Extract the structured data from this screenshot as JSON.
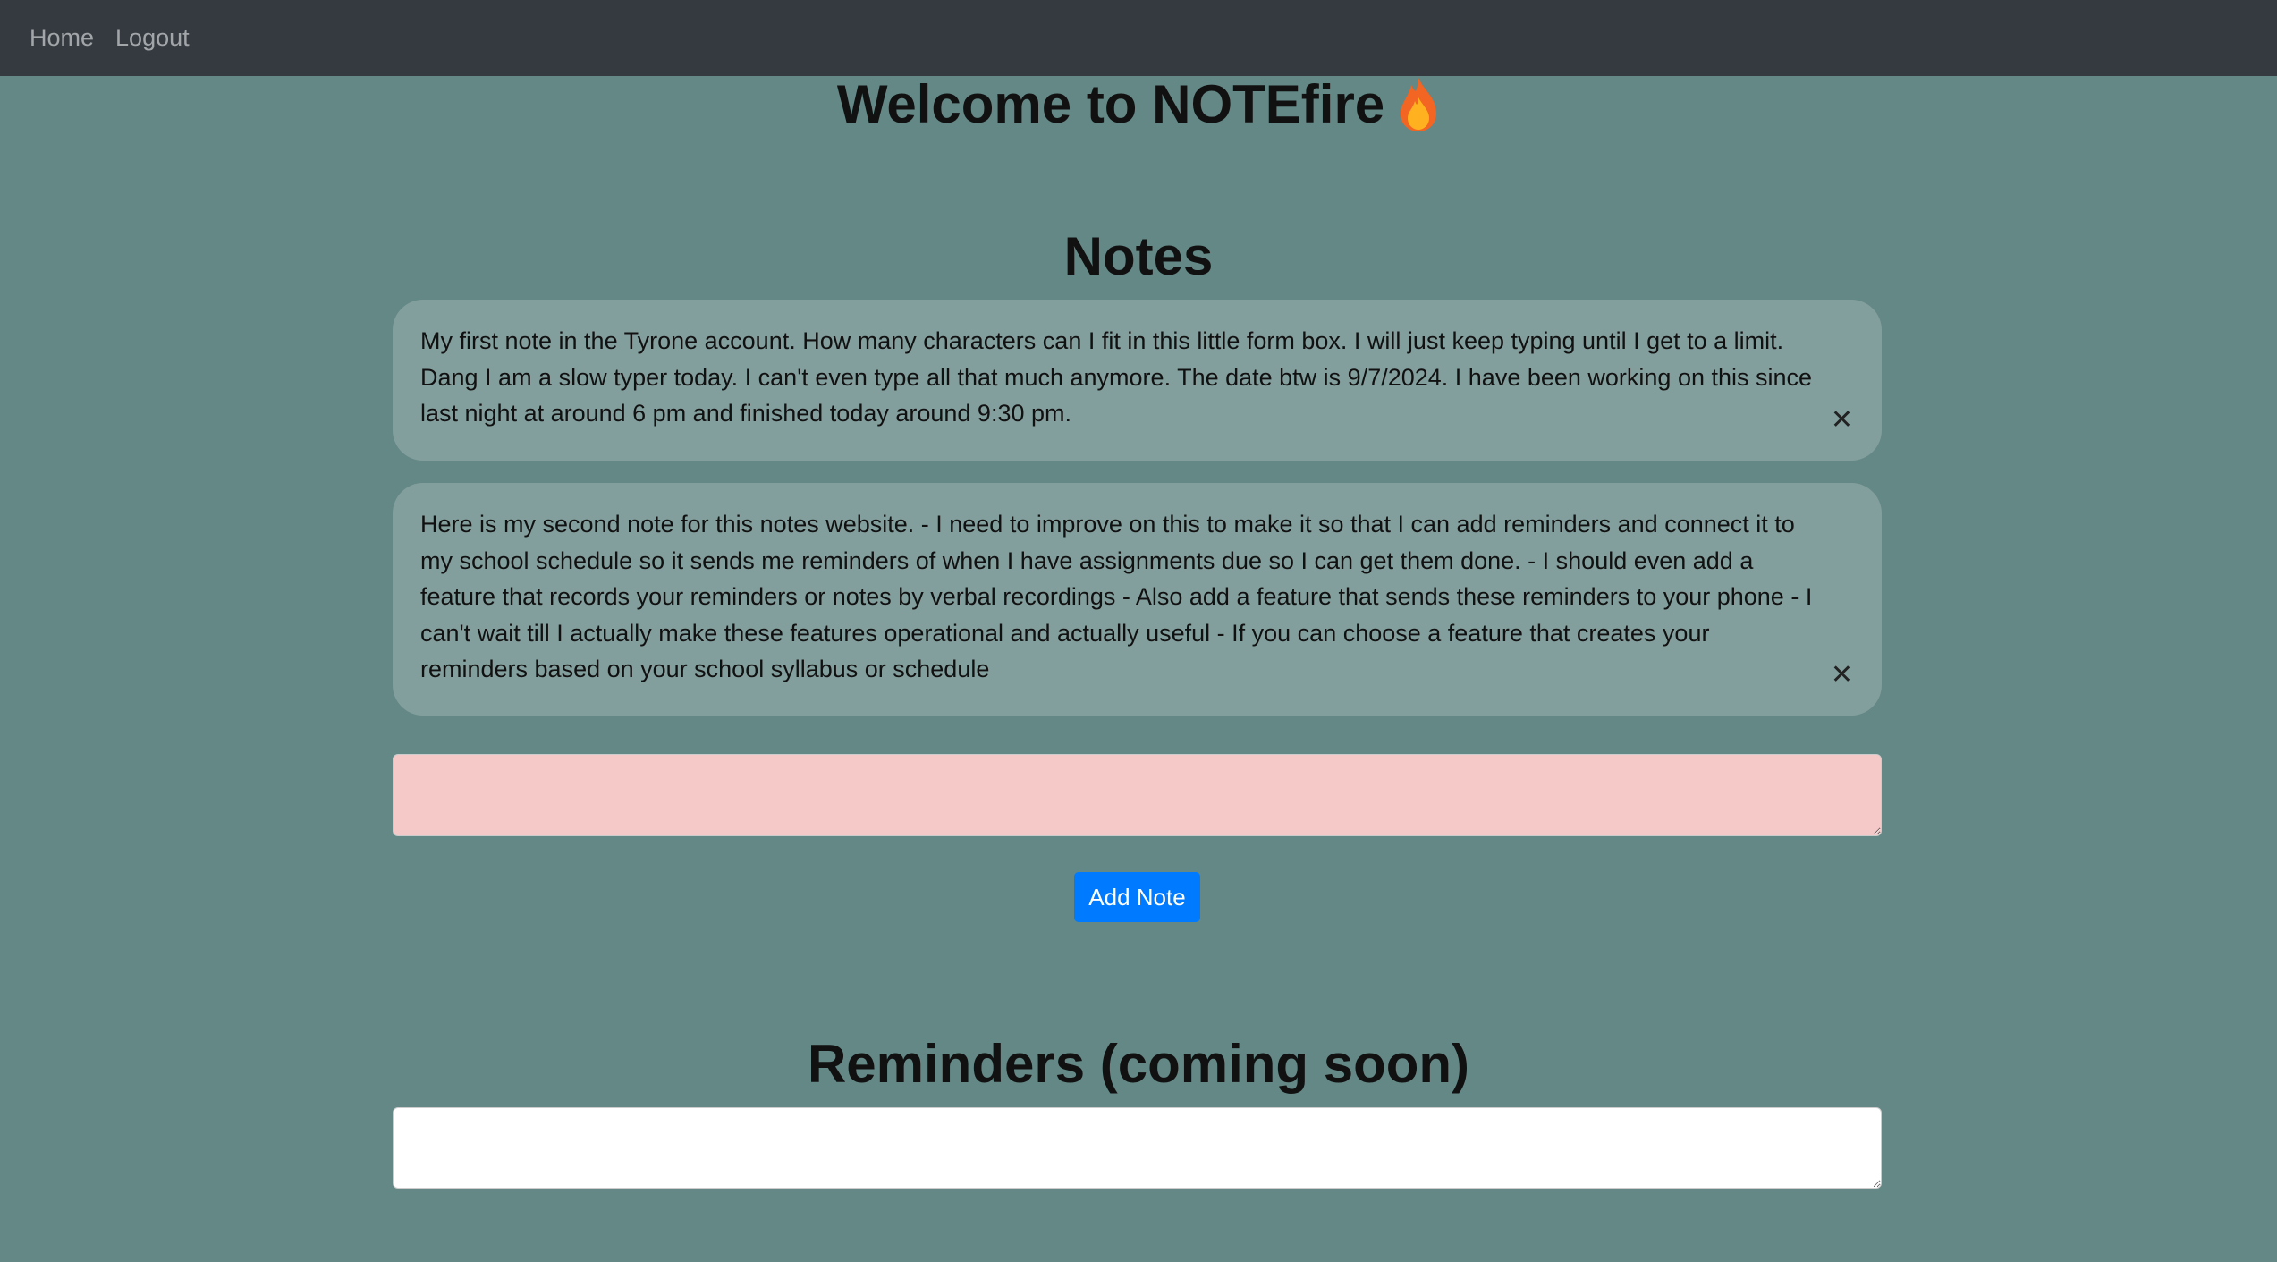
{
  "nav": {
    "home_label": "Home",
    "logout_label": "Logout"
  },
  "header": {
    "title": "Welcome to NOTEfire",
    "icon": "flame-icon"
  },
  "notes": {
    "heading": "Notes",
    "items": [
      {
        "text": "My first note in the Tyrone account. How many characters can I fit in this little form box. I will just keep typing until I get to a limit. Dang I am a slow typer today. I can't even type all that much anymore. The date btw is 9/7/2024. I have been working on this since last night at around 6 pm and finished today around 9:30 pm.",
        "close_glyph": "✕"
      },
      {
        "text": "Here is my second note for this notes website. - I need to improve on this to make it so that I can add reminders and connect it to my school schedule so it sends me reminders of when I have assignments due so I can get them done. - I should even add a feature that records your reminders or notes by verbal recordings - Also add a feature that sends these reminders to your phone - I can't wait till I actually make these features operational and actually useful - If you can choose a feature that creates your reminders based on your school syllabus or schedule",
        "close_glyph": "✕"
      }
    ],
    "input_value": "",
    "add_button_label": "Add Note"
  },
  "reminders": {
    "heading": "Reminders (coming soon)",
    "input_value": ""
  },
  "colors": {
    "background": "#638886",
    "navbar": "#343a40",
    "note_card": "#839f9d",
    "note_input": "#f6c9c9",
    "button": "#007bff"
  }
}
